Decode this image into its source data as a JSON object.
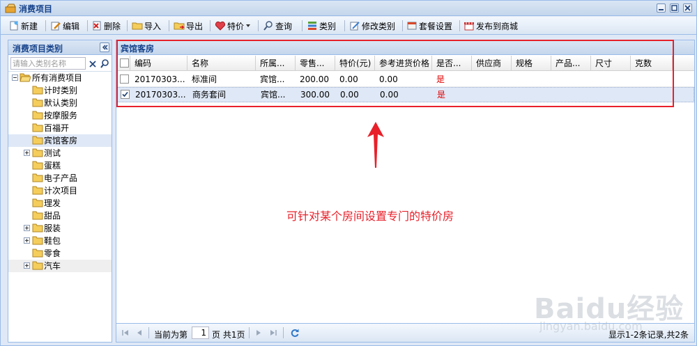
{
  "window": {
    "title": "消费项目"
  },
  "toolbar": {
    "new_label": "新建",
    "edit_label": "编辑",
    "delete_label": "删除",
    "import_label": "导入",
    "export_label": "导出",
    "special_price_label": "特价",
    "query_label": "查询",
    "category_label": "类别",
    "edit_category_label": "修改类别",
    "package_settings_label": "套餐设置",
    "publish_label": "发布到商城"
  },
  "sidebar": {
    "title": "消费项目类别",
    "search_placeholder": "请输入类别名称",
    "root_label": "所有消费项目",
    "items": [
      {
        "label": "计时类别",
        "expandable": false
      },
      {
        "label": "默认类别",
        "expandable": false
      },
      {
        "label": "按摩服务",
        "expandable": false
      },
      {
        "label": "百福开",
        "expandable": false
      },
      {
        "label": "宾馆客房",
        "expandable": false,
        "selected": true
      },
      {
        "label": "测试",
        "expandable": true
      },
      {
        "label": "蛋糕",
        "expandable": false
      },
      {
        "label": "电子产品",
        "expandable": false
      },
      {
        "label": "计次项目",
        "expandable": false
      },
      {
        "label": "理发",
        "expandable": false
      },
      {
        "label": "甜品",
        "expandable": false
      },
      {
        "label": "服装",
        "expandable": true
      },
      {
        "label": "鞋包",
        "expandable": true
      },
      {
        "label": "零食",
        "expandable": false
      },
      {
        "label": "汽车",
        "expandable": true
      }
    ]
  },
  "grid": {
    "title": "宾馆客房",
    "columns": [
      "编码",
      "名称",
      "所属...",
      "零售...",
      "特价(元)",
      "参考进货价格",
      "是否...",
      "供应商",
      "规格",
      "产品...",
      "尺寸",
      "克数"
    ],
    "rows": [
      {
        "checked": false,
        "code": "20170303...",
        "name": "标准间",
        "category": "宾馆...",
        "retail": "200.00",
        "special": "0.00",
        "ref_price": "0.00",
        "flag": "是"
      },
      {
        "checked": true,
        "code": "20170303...",
        "name": "商务套间",
        "category": "宾馆...",
        "retail": "300.00",
        "special": "0.00",
        "ref_price": "0.00",
        "flag": "是"
      }
    ]
  },
  "pager": {
    "before_page": "当前为第",
    "page": "1",
    "after_page": "页 共1页",
    "summary": "显示1-2条记录,共2条"
  },
  "annotation": {
    "text": "可针对某个房间设置专门的特价房"
  },
  "watermark": {
    "logo": "Baidu经验",
    "url": "jingyan.baidu.com"
  },
  "colors": {
    "panel_border": "#99bbe8",
    "header_text": "#15428b",
    "annotation": "#e8202a",
    "selected_row": "#dfe8f6"
  }
}
